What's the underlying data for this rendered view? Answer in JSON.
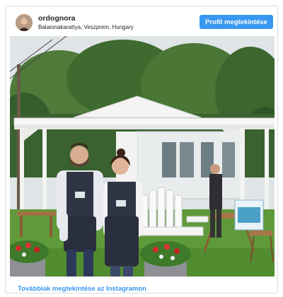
{
  "post": {
    "username": "ordognora",
    "location": "Balatonakarattya, Veszprem, Hungary",
    "profile_button_label": "Profil megtekintése",
    "more_link_label": "Továbbiak megtekintése az Instagramon"
  },
  "colors": {
    "accent": "#3897f0",
    "text": "#262626",
    "border": "#dbdbdb"
  }
}
